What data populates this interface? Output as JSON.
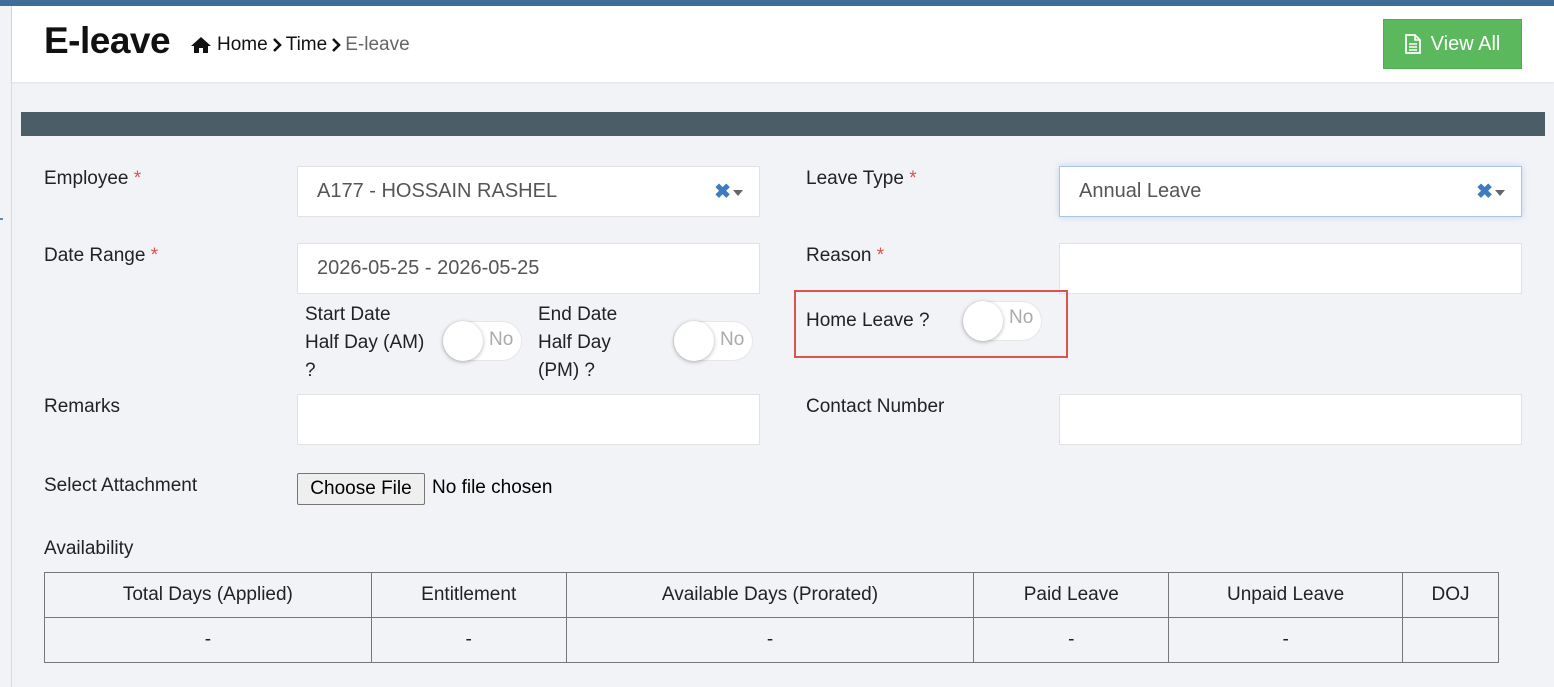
{
  "header": {
    "title": "E-leave",
    "breadcrumb": [
      "Home",
      "Time",
      "E-leave"
    ],
    "view_all_label": "View All"
  },
  "form": {
    "employee": {
      "label": "Employee",
      "required_mark": "*",
      "value": "A177 - HOSSAIN RASHEL"
    },
    "leave_type": {
      "label": "Leave Type",
      "required_mark": "*",
      "value": "Annual Leave"
    },
    "date_range": {
      "label": "Date Range",
      "required_mark": "*",
      "value": "2026-05-25 - 2026-05-25"
    },
    "reason": {
      "label": "Reason",
      "required_mark": "*",
      "value": ""
    },
    "start_half_day": {
      "label_lines": [
        "Start Date",
        "Half Day (AM)",
        "?"
      ],
      "state": "No"
    },
    "end_half_day": {
      "label_lines": [
        "End Date",
        "Half Day",
        "(PM) ?"
      ],
      "state": "No"
    },
    "home_leave": {
      "label": "Home Leave ?",
      "state": "No"
    },
    "remarks": {
      "label": "Remarks",
      "value": ""
    },
    "contact_number": {
      "label": "Contact Number",
      "value": ""
    },
    "attachment": {
      "label": "Select Attachment",
      "button_label": "Choose File",
      "status": "No file chosen"
    }
  },
  "availability": {
    "title": "Availability",
    "columns": [
      "Total Days (Applied)",
      "Entitlement",
      "Available Days (Prorated)",
      "Paid Leave",
      "Unpaid Leave",
      "DOJ"
    ],
    "rows": [
      [
        "-",
        "-",
        "-",
        "-",
        "-",
        ""
      ]
    ]
  },
  "colors": {
    "top_stripe": "#3e6e97",
    "section_bar": "#4b5e67",
    "view_all_button": "#5cb85c",
    "required_mark": "#d9534f",
    "highlight_box": "#d9534f",
    "clear_icon": "#3e7bbf"
  },
  "icons": [
    "home-icon",
    "chevron-right-icon",
    "document-icon",
    "clear-icon",
    "dropdown-caret-icon"
  ]
}
